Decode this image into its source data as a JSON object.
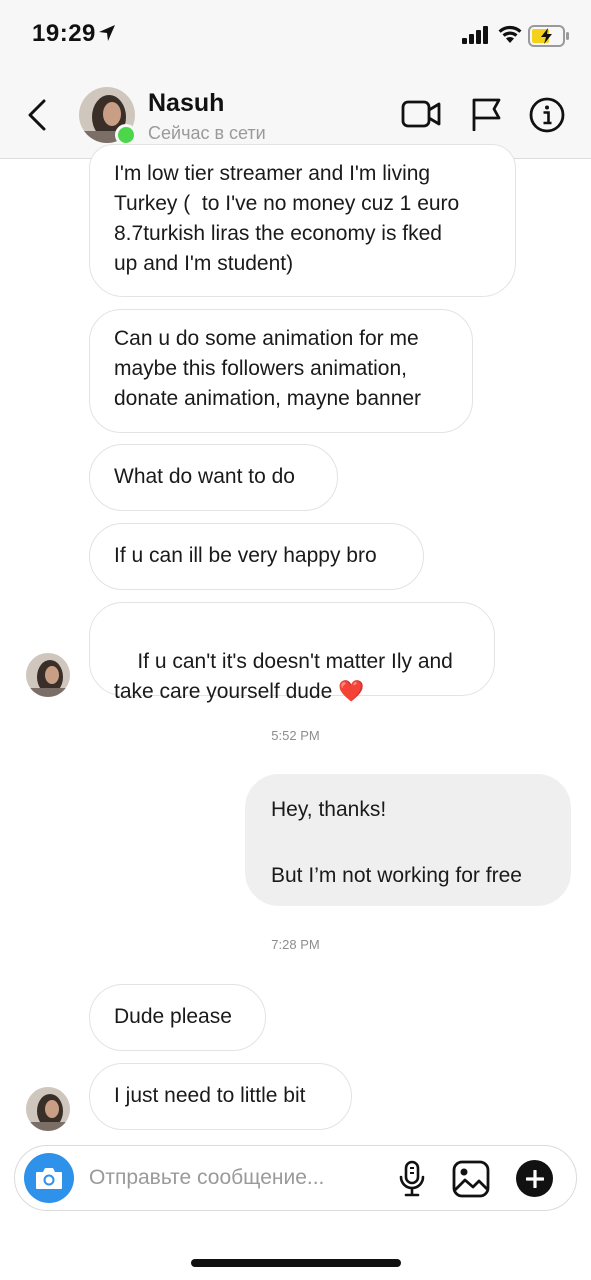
{
  "status_bar": {
    "time": "19:29",
    "battery_color": "#f4d21c"
  },
  "header": {
    "contact_name": "Nasuh",
    "contact_status": "Сейчас в сети",
    "online_color": "#4cd64a"
  },
  "messages": [
    {
      "text": "I'm low tier streamer and I'm living\nTurkey (  to I've no money cuz 1 euro\n8.7turkish liras the economy is fked\nup and I'm student)"
    },
    {
      "text": "Can u do some animation for me\nmaybe this followers animation,\ndonate animation, mayne banner"
    },
    {
      "text": "What do want to do"
    },
    {
      "text": "If u can ill be very happy bro"
    },
    {
      "text": "If u can't it's doesn't matter Ily and\ntake care yourself dude ",
      "emoji": "❤️"
    },
    {
      "timestamp": "5:52 PM"
    },
    {
      "text": "Hey, thanks!\n\nBut I’m not working for free"
    },
    {
      "timestamp": "7:28 PM"
    },
    {
      "text": "Dude please"
    },
    {
      "text": "I just need to little bit"
    }
  ],
  "composer": {
    "placeholder": "Отправьте сообщение...",
    "camera_color": "#2e92ea"
  }
}
